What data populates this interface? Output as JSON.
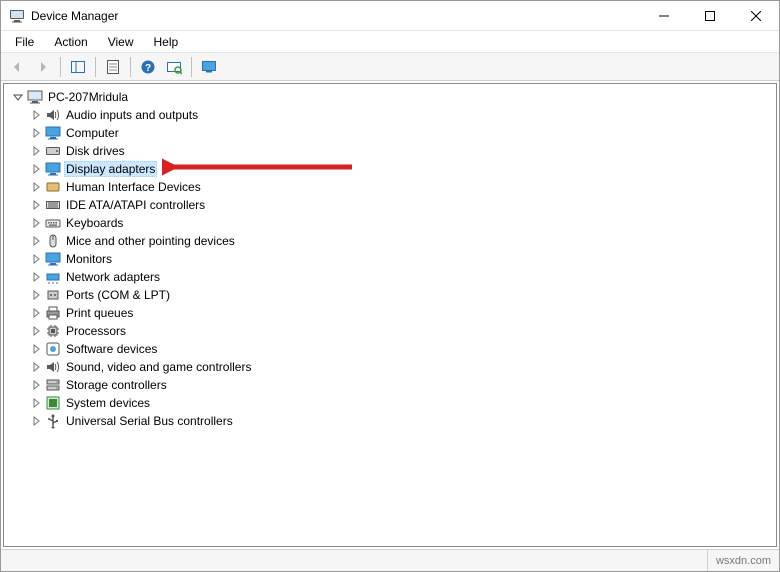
{
  "titlebar": {
    "title": "Device Manager"
  },
  "menubar": {
    "items": [
      "File",
      "Action",
      "View",
      "Help"
    ]
  },
  "tree": {
    "root": {
      "label": "PC-207Mridula",
      "expanded": true
    },
    "children": [
      {
        "label": "Audio inputs and outputs",
        "icon": "speaker"
      },
      {
        "label": "Computer",
        "icon": "monitor"
      },
      {
        "label": "Disk drives",
        "icon": "disk"
      },
      {
        "label": "Display adapters",
        "icon": "monitor",
        "selected": true
      },
      {
        "label": "Human Interface Devices",
        "icon": "hid"
      },
      {
        "label": "IDE ATA/ATAPI controllers",
        "icon": "ide"
      },
      {
        "label": "Keyboards",
        "icon": "keyboard"
      },
      {
        "label": "Mice and other pointing devices",
        "icon": "mouse"
      },
      {
        "label": "Monitors",
        "icon": "monitor"
      },
      {
        "label": "Network adapters",
        "icon": "network"
      },
      {
        "label": "Ports (COM & LPT)",
        "icon": "port"
      },
      {
        "label": "Print queues",
        "icon": "printer"
      },
      {
        "label": "Processors",
        "icon": "cpu"
      },
      {
        "label": "Software devices",
        "icon": "software"
      },
      {
        "label": "Sound, video and game controllers",
        "icon": "speaker"
      },
      {
        "label": "Storage controllers",
        "icon": "storage"
      },
      {
        "label": "System devices",
        "icon": "system"
      },
      {
        "label": "Universal Serial Bus controllers",
        "icon": "usb"
      }
    ]
  },
  "statusbar": {
    "watermark": "wsxdn.com"
  }
}
